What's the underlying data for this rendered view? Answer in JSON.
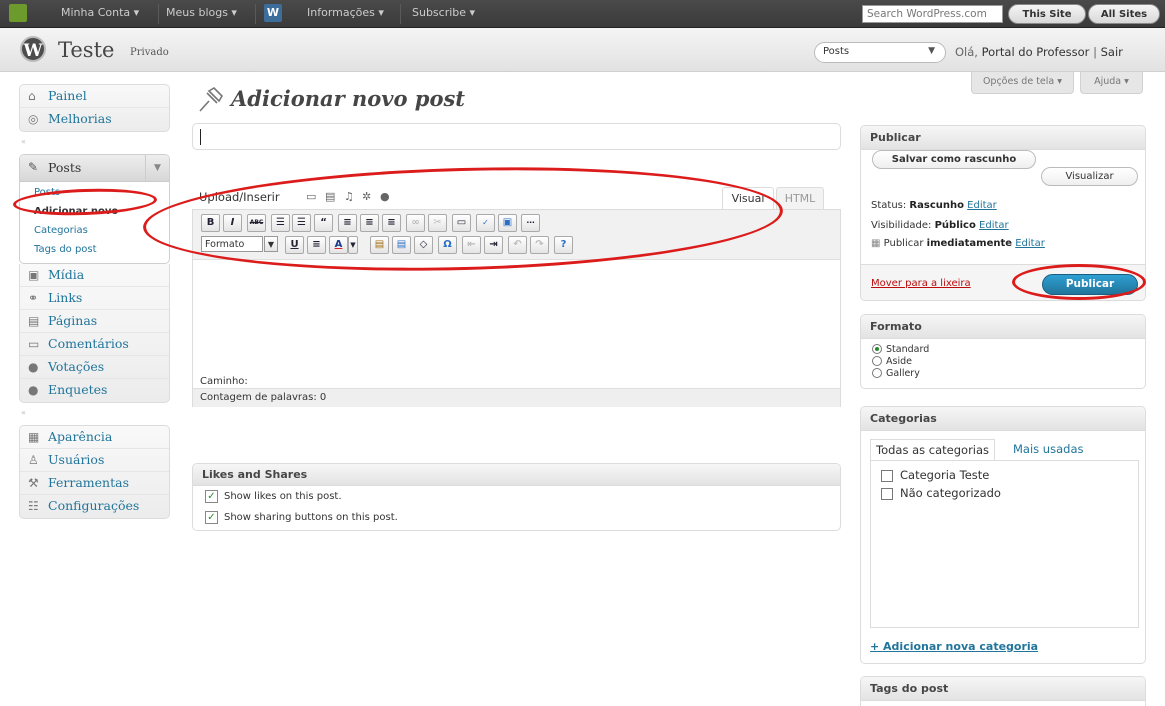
{
  "adminbar": {
    "items": [
      "Minha Conta ▾",
      "Meus blogs ▾",
      "Informações ▾",
      "Subscribe ▾"
    ],
    "search_placeholder": "Search WordPress.com",
    "this_site": "This Site",
    "all_sites": "All Sites"
  },
  "header": {
    "logo": "W",
    "site_title": "Teste",
    "site_private": "Privado",
    "posts_select": "Posts",
    "greeting_prefix": "Olá, ",
    "user": "Portal do Professor",
    "separator": " | ",
    "logout": "Sair"
  },
  "screen_options": {
    "options": "Opções de tela ▾",
    "help": "Ajuda ▾"
  },
  "sidebar": {
    "top": [
      {
        "label": "Painel",
        "icon": "home-icon"
      },
      {
        "label": "Melhorias",
        "icon": "upgrades-icon"
      }
    ],
    "posts": {
      "label": "Posts",
      "items": [
        {
          "label": "Posts",
          "current": false
        },
        {
          "label": "Adicionar novo",
          "current": true
        },
        {
          "label": "Categorias",
          "current": false
        },
        {
          "label": "Tags do post",
          "current": false
        }
      ]
    },
    "content": [
      {
        "label": "Mídia",
        "icon": "media-icon"
      },
      {
        "label": "Links",
        "icon": "links-icon"
      },
      {
        "label": "Páginas",
        "icon": "pages-icon"
      },
      {
        "label": "Comentários",
        "icon": "comments-icon"
      },
      {
        "label": "Votações",
        "icon": "polls-icon"
      },
      {
        "label": "Enquetes",
        "icon": "ratings-icon"
      }
    ],
    "settings": [
      {
        "label": "Aparência",
        "icon": "appearance-icon"
      },
      {
        "label": "Usuários",
        "icon": "users-icon"
      },
      {
        "label": "Ferramentas",
        "icon": "tools-icon"
      },
      {
        "label": "Configurações",
        "icon": "settings-icon"
      }
    ]
  },
  "page": {
    "title": "Adicionar novo post"
  },
  "editor": {
    "upload_label": "Upload/Inserir",
    "tab_visual": "Visual",
    "tab_html": "HTML",
    "format_select": "Formato",
    "path_label": "Caminho:",
    "word_count": "Contagem de palavras: 0"
  },
  "likes": {
    "title": "Likes and Shares",
    "show_likes": "Show likes on this post.",
    "show_sharing": "Show sharing buttons on this post."
  },
  "publish": {
    "title": "Publicar",
    "save_draft": "Salvar como rascunho",
    "preview": "Visualizar",
    "status_label": "Status: ",
    "status_value": "Rascunho",
    "visibility_label": "Visibilidade: ",
    "visibility_value": "Público",
    "schedule_label": "Publicar ",
    "schedule_value": "imediatamente",
    "edit": "Editar",
    "trash": "Mover para a lixeira",
    "publish_button": "Publicar"
  },
  "format": {
    "title": "Formato",
    "options": [
      {
        "label": "Standard",
        "selected": true
      },
      {
        "label": "Aside",
        "selected": false
      },
      {
        "label": "Gallery",
        "selected": false
      }
    ]
  },
  "categories": {
    "title": "Categorias",
    "tab_all": "Todas as categorias",
    "tab_popular": "Mais usadas",
    "items": [
      "Categoria Teste",
      "Não categorizado"
    ],
    "add_new": "+ Adicionar nova categoria"
  },
  "tags": {
    "title": "Tags do post"
  },
  "colors": {
    "link": "#21759b",
    "annotation": "#dc1b1b",
    "publish": "#21759b"
  }
}
